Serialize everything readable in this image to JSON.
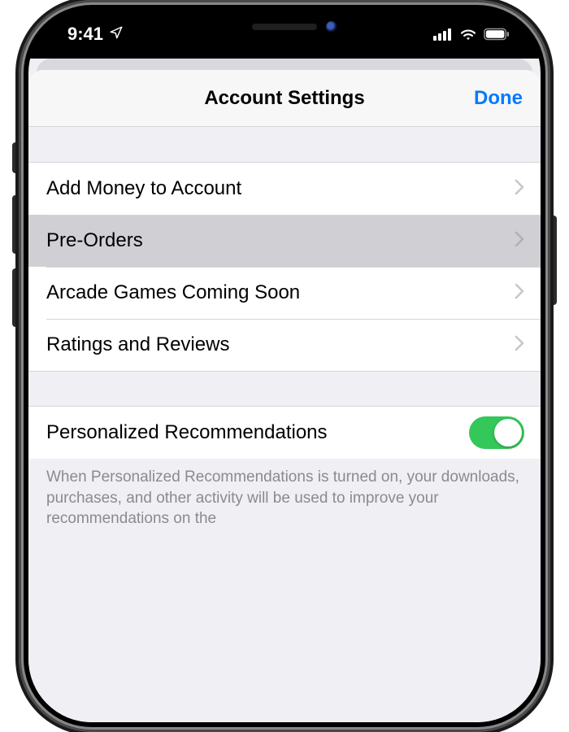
{
  "status_bar": {
    "time": "9:41"
  },
  "header": {
    "title": "Account Settings",
    "done_label": "Done"
  },
  "section1": {
    "rows": [
      {
        "label": "Add Money to Account",
        "highlight": false
      },
      {
        "label": "Pre-Orders",
        "highlight": true
      },
      {
        "label": "Arcade Games Coming Soon",
        "highlight": false
      },
      {
        "label": "Ratings and Reviews",
        "highlight": false
      }
    ]
  },
  "section2": {
    "toggle_label": "Personalized Recommendations",
    "toggle_on": true,
    "footer": "When Personalized Recommendations is turned on, your downloads, purchases, and other activity will be used to improve your recommendations on the"
  }
}
